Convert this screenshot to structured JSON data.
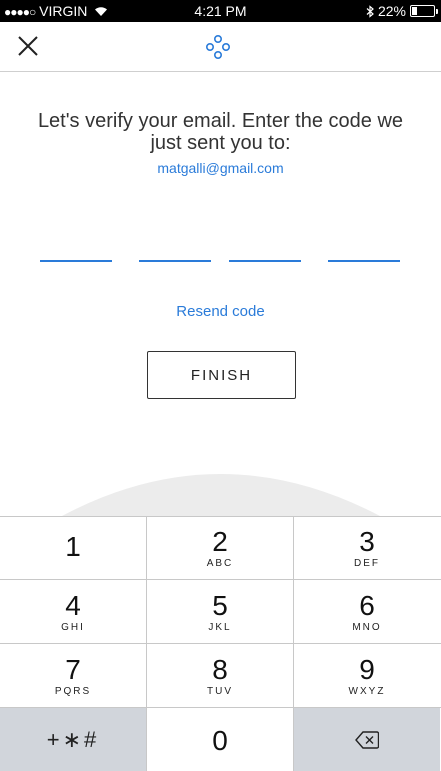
{
  "status_bar": {
    "carrier": "VIRGIN",
    "time": "4:21 PM",
    "battery_text": "22%",
    "battery_level": 0.22
  },
  "nav": {
    "close_icon": "close-icon",
    "logo_icon": "app-logo-icon"
  },
  "content": {
    "prompt": "Let's verify your email. Enter the code we just sent you to:",
    "email": "matgalli@gmail.com",
    "code_digits": [
      "",
      "",
      "",
      ""
    ],
    "resend_label": "Resend code",
    "finish_label": "FINISH"
  },
  "keypad": {
    "keys": [
      {
        "num": "1",
        "letters": ""
      },
      {
        "num": "2",
        "letters": "ABC"
      },
      {
        "num": "3",
        "letters": "DEF"
      },
      {
        "num": "4",
        "letters": "GHI"
      },
      {
        "num": "5",
        "letters": "JKL"
      },
      {
        "num": "6",
        "letters": "MNO"
      },
      {
        "num": "7",
        "letters": "PQRS"
      },
      {
        "num": "8",
        "letters": "TUV"
      },
      {
        "num": "9",
        "letters": "WXYZ"
      },
      {
        "num": "0",
        "letters": ""
      }
    ],
    "symbols_label": "+∗#",
    "delete_icon": "backspace-icon"
  },
  "colors": {
    "accent": "#2a7bd9",
    "keypad_gray": "#d1d5db"
  }
}
